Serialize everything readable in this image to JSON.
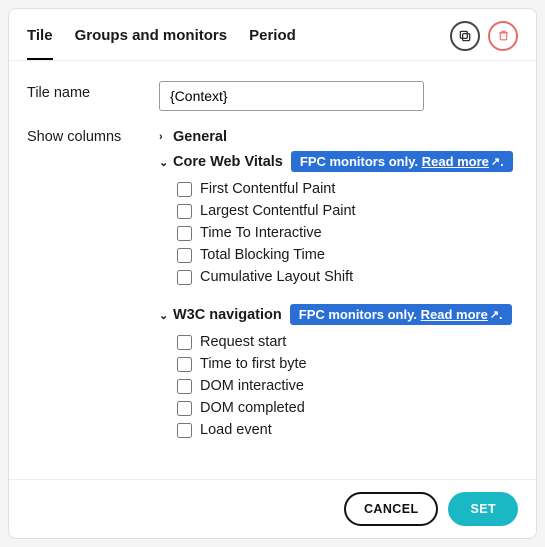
{
  "tabs": {
    "tile": "Tile",
    "groups": "Groups and monitors",
    "period": "Period"
  },
  "form": {
    "tile_name_label": "Tile name",
    "tile_name_value": "{Context}",
    "show_columns_label": "Show columns"
  },
  "sections": {
    "general": {
      "title": "General"
    },
    "cwv": {
      "title": "Core Web Vitals",
      "badge_prefix": "FPC monitors only.",
      "badge_link": "Read more",
      "items": [
        "First Contentful Paint",
        "Largest Contentful Paint",
        "Time To Interactive",
        "Total Blocking Time",
        "Cumulative Layout Shift"
      ]
    },
    "w3c": {
      "title": "W3C navigation",
      "badge_prefix": "FPC monitors only.",
      "badge_link": "Read more",
      "items": [
        "Request start",
        "Time to first byte",
        "DOM interactive",
        "DOM completed",
        "Load event"
      ]
    }
  },
  "footer": {
    "cancel": "CANCEL",
    "set": "SET"
  }
}
